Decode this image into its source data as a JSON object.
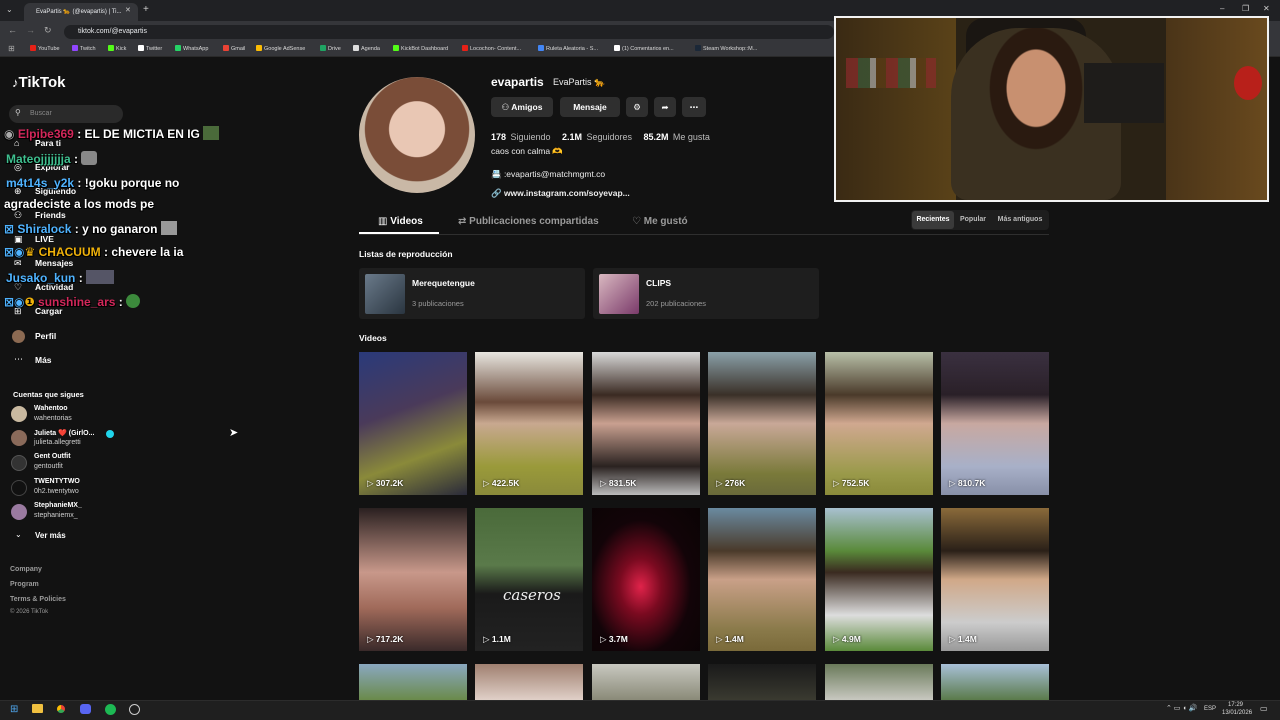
{
  "browser": {
    "tab_title": "EvaPartis 🐆 (@evapartis) | Ti...",
    "url": "tiktok.com/@evapartis",
    "bookmarks": [
      "YouTube",
      "Twitch",
      "Kick",
      "Twitter",
      "WhatsApp",
      "Gmail",
      "Google AdSense",
      "Drive",
      "Agenda",
      "KickBot Dashboard",
      "Locochon- Content...",
      "Ruleta Aleatoria - S...",
      "(1) Comentarios en...",
      "Steam Workshop::M..."
    ]
  },
  "sidebar": {
    "logo": "TikTok",
    "search_placeholder": "Buscar",
    "nav": [
      "Para ti",
      "Explorar",
      "Siguiendo",
      "Friends",
      "LIVE",
      "Mensajes",
      "Actividad",
      "Cargar",
      "Perfil",
      "Más"
    ],
    "following_title": "Cuentas que sigues",
    "following": [
      {
        "name": "Wahentoo",
        "handle": "wahentorias"
      },
      {
        "name": "Julieta ❤️ (GirlO...",
        "handle": "julieta.allegretti"
      },
      {
        "name": "Gent Outfit",
        "handle": "gentoutfit"
      },
      {
        "name": "TWENTYTWO",
        "handle": "0h2.twentytwo"
      },
      {
        "name": "StephanieMX_",
        "handle": "stephaniemx_"
      }
    ],
    "see_more": "Ver más",
    "footer": [
      "Company",
      "Program",
      "Terms & Policies",
      "© 2026 TikTok"
    ]
  },
  "chat": [
    {
      "user": "Elpibe369",
      "msg": ": EL DE MICTIA EN IG",
      "color": "#d2275a"
    },
    {
      "user": "Mateojjjjjjja",
      "msg": ":",
      "color": "#3fbf8f"
    },
    {
      "user": "m4t14s_y2k",
      "msg": ": !goku porque no",
      "color": "#4fb3ff"
    },
    {
      "user": "",
      "msg": "agradeciste a los mods pe",
      "color": "#ffffff"
    },
    {
      "user": "Shiralock",
      "msg": ": y no ganaron",
      "color": "#4fb3ff"
    },
    {
      "user": "CHACUUM",
      "msg": ": chevere la ia",
      "color": "#f0b20a"
    },
    {
      "user": "Jusako_kun",
      "msg": ":",
      "color": "#4fb3ff"
    },
    {
      "user": "sunshine_ars",
      "msg": ":",
      "color": "#d2275a"
    }
  ],
  "profile": {
    "username": "evapartis",
    "display_name": "EvaPartis 🐆",
    "buttons": {
      "friends": "Amigos",
      "message": "Mensaje"
    },
    "following_count": "178",
    "following_label": "Siguiendo",
    "followers_count": "2.1M",
    "followers_label": "Seguidores",
    "likes_count": "85.2M",
    "likes_label": "Me gusta",
    "bio": "caos con calma 🫶",
    "email": "📇 :evapartis@matchmgmt.co",
    "link": "🔗 www.instagram.com/soyevap..."
  },
  "tabs": [
    "Videos",
    "Publicaciones compartidas",
    "Me gustó"
  ],
  "sort": [
    "Recientes",
    "Popular",
    "Más antiguos"
  ],
  "playlists_title": "Listas de reproducción",
  "playlists": [
    {
      "title": "Merequetengue",
      "count": "3 publicaciones"
    },
    {
      "title": "CLIPS",
      "count": "202 publicaciones"
    }
  ],
  "videos_title": "Videos",
  "videos": [
    "307.2K",
    "422.5K",
    "831.5K",
    "276K",
    "752.5K",
    "810.7K",
    "717.2K",
    "1.1M",
    "3.7M",
    "1.4M",
    "4.9M",
    "1.4M"
  ],
  "taskbar": {
    "lang": "ESP",
    "time": "17:29",
    "date": "13/01/2026"
  }
}
